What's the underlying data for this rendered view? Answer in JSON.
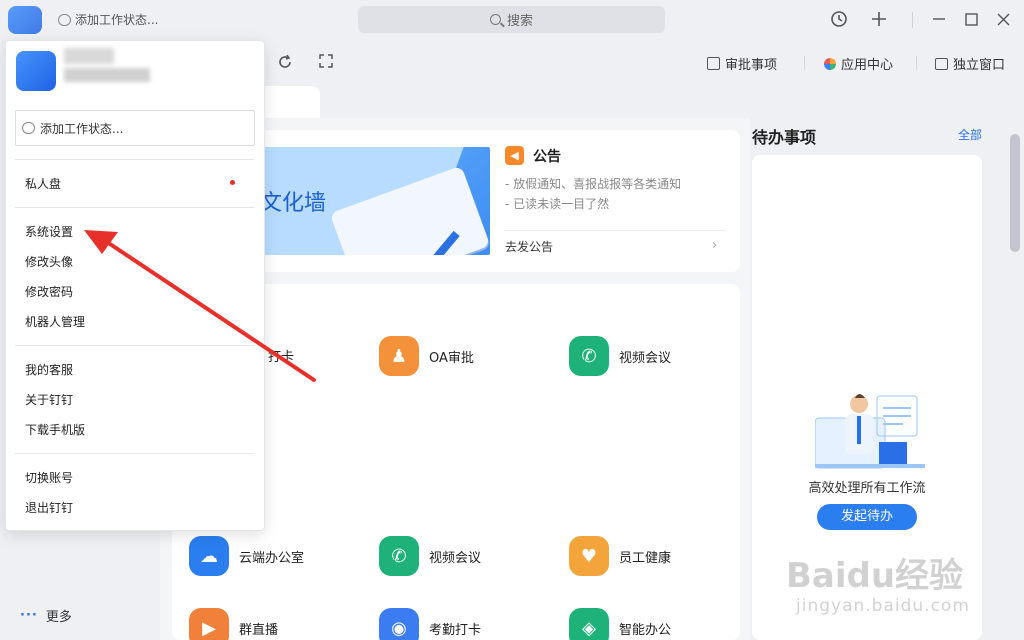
{
  "titlebar": {
    "status_text": "添加工作状态...",
    "search_placeholder": "搜索",
    "icons": [
      "history-icon",
      "plus-icon",
      "minimize-icon",
      "maximize-icon",
      "close-icon"
    ]
  },
  "toolbar": {
    "approval": "审批事项",
    "app_center": "应用中心",
    "standalone": "独立窗口"
  },
  "announcement": {
    "banner_text": "文化墙",
    "title": "公告",
    "lines": [
      "- 放假通知、喜报战报等各类通知",
      "- 已读未读一目了然"
    ],
    "action": "去发公告"
  },
  "apps": [
    {
      "label": "打卡",
      "color": "#3b7cf2"
    },
    {
      "label": "OA审批",
      "color": "#f3923a"
    },
    {
      "label": "视频会议",
      "color": "#1fb17a"
    },
    {
      "label": "云端办公室",
      "color": "#2b7ef0"
    },
    {
      "label": "视频会议",
      "color": "#1fb17a"
    },
    {
      "label": "员工健康",
      "color": "#f3a43a"
    },
    {
      "label": "群直播",
      "color": "#f0803a"
    },
    {
      "label": "考勤打卡",
      "color": "#3b7cf2"
    },
    {
      "label": "智能办公",
      "color": "#1fb17a"
    }
  ],
  "todo": {
    "title": "待办事项",
    "all": "全部",
    "description": "高效处理所有工作流",
    "button": "发起待办"
  },
  "leftnav": {
    "more": "更多"
  },
  "menu": {
    "status_placeholder": "添加工作状态...",
    "items": {
      "private_disk": "私人盘",
      "system_settings": "系统设置",
      "change_avatar": "修改头像",
      "change_password": "修改密码",
      "robot_management": "机器人管理",
      "my_service": "我的客服",
      "about": "关于钉钉",
      "download_mobile": "下载手机版",
      "switch_account": "切换账号",
      "exit": "退出钉钉"
    }
  },
  "watermark": {
    "main": "Baidu经验",
    "sub": "jingyan.baidu.com"
  },
  "colors": {
    "accent": "#2b7ef0",
    "annotation_arrow": "#e8302a",
    "notification_dot": "#e52b2b"
  }
}
